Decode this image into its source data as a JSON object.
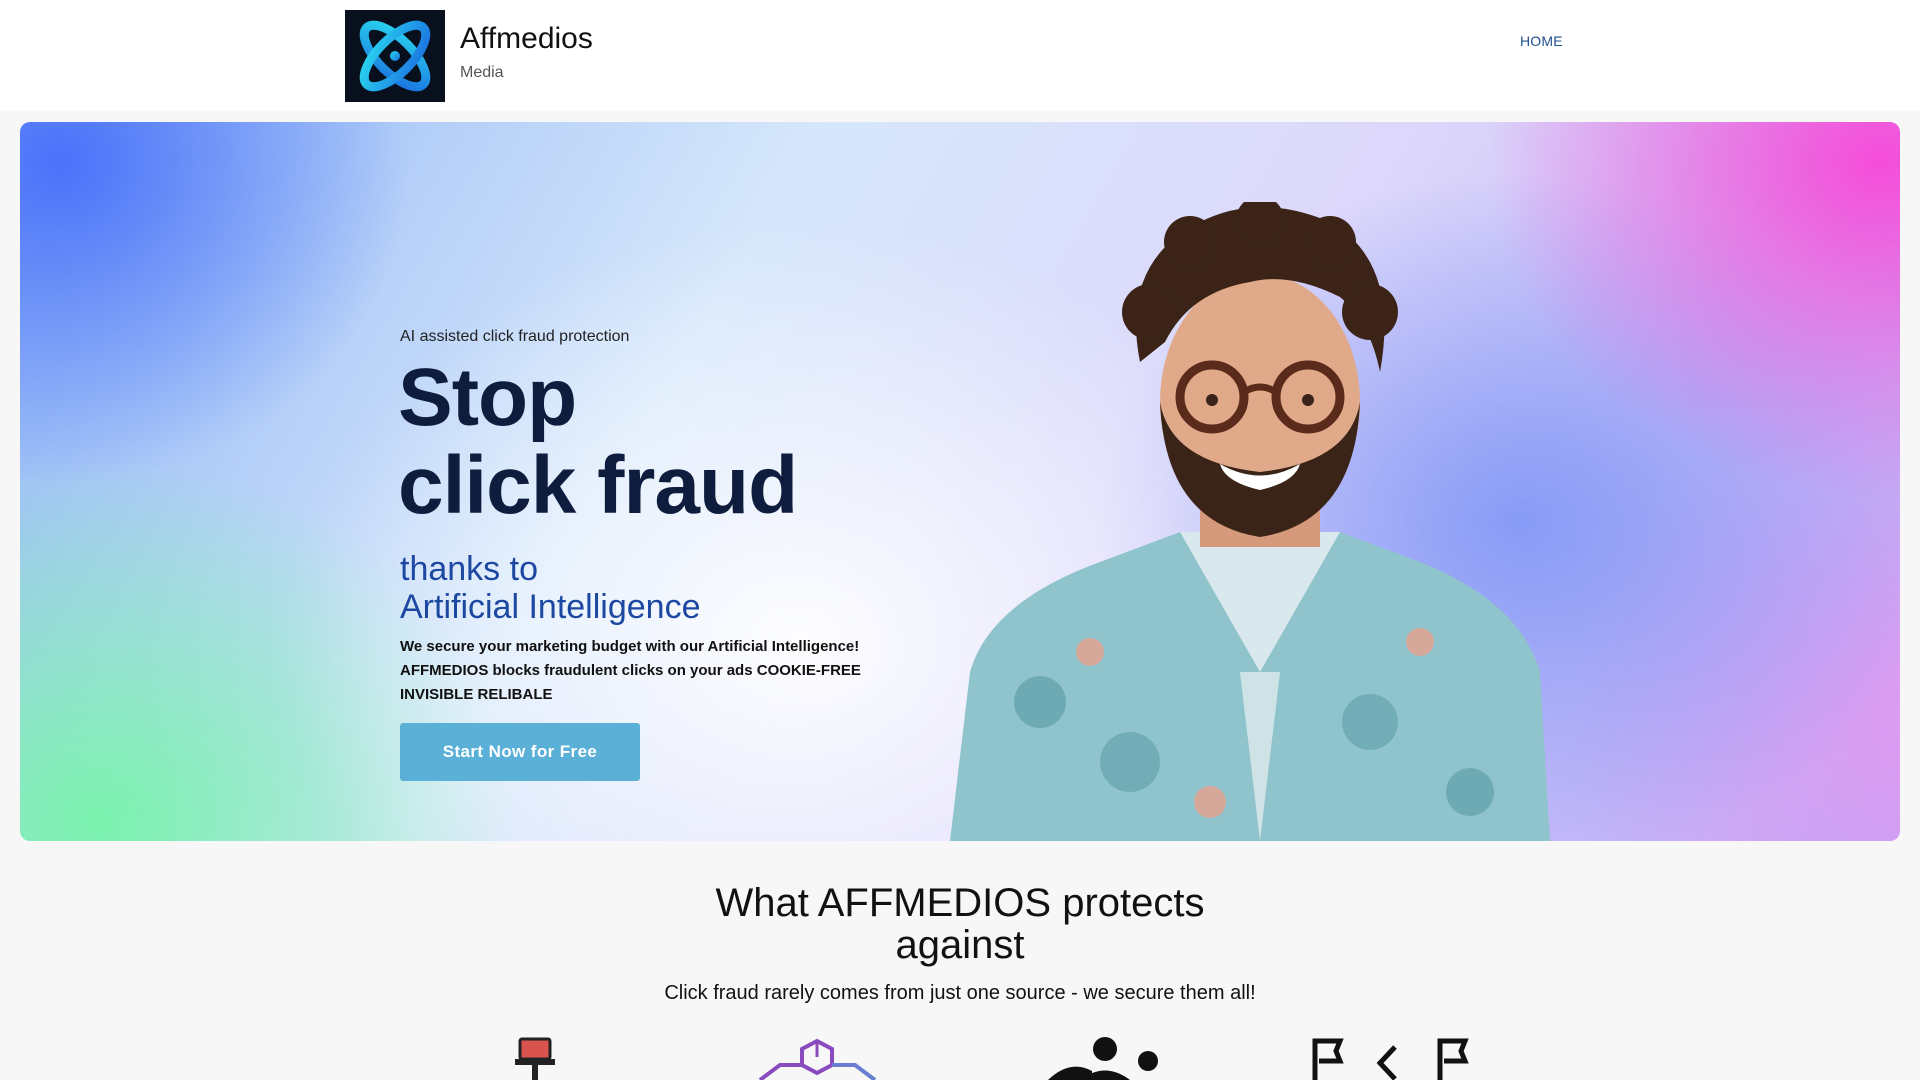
{
  "header": {
    "brand_name": "Affmedios",
    "brand_sub": "Media",
    "nav": [
      {
        "label": "HOME"
      }
    ]
  },
  "hero": {
    "kicker": "AI assisted click fraud protection",
    "title_line1": "Stop",
    "title_line2": "click fraud",
    "subtitle_line1": "thanks to",
    "subtitle_line2": "Artificial Intelligence",
    "body_line1": "We secure your marketing budget with our Artificial Intelligence!",
    "body_line2": "AFFMEDIOS blocks fraudulent clicks on your ads COOKIE-FREE",
    "body_line3": "INVISIBLE RELIBALE",
    "cta_label": "Start Now for Free"
  },
  "section": {
    "title_line1": "What AFFMEDIOS protects",
    "title_line2": "against",
    "subtitle": "Click fraud rarely comes from just one source - we secure them all!"
  },
  "colors": {
    "nav_link": "#1f4f8f",
    "hero_title": "#0e1d3e",
    "hero_subtitle": "#1c48a1",
    "cta_bg": "#5ab0d6"
  },
  "icons": {
    "logo": "orbit-logo-icon",
    "features": [
      "computer-chair-icon",
      "blockchain-cubes-icon",
      "people-group-icon",
      "flags-icon"
    ]
  }
}
